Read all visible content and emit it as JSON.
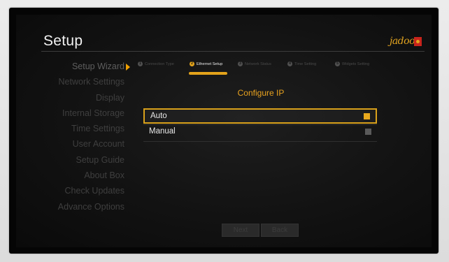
{
  "header": {
    "title": "Setup",
    "brand": "jadoo"
  },
  "sidebar": {
    "items": [
      {
        "label": "Setup Wizard",
        "active": true
      },
      {
        "label": "Network Settings"
      },
      {
        "label": "Display"
      },
      {
        "label": "Internal Storage"
      },
      {
        "label": "Time Settings"
      },
      {
        "label": "User Account"
      },
      {
        "label": "Setup Guide"
      },
      {
        "label": "About Box"
      },
      {
        "label": "Check Updates"
      },
      {
        "label": "Advance Options"
      }
    ]
  },
  "wizard": {
    "steps": [
      {
        "num": "1",
        "label": "Connection Type"
      },
      {
        "num": "2",
        "label": "Ethernet Setup",
        "active": true
      },
      {
        "num": "3",
        "label": "Network Status"
      },
      {
        "num": "4",
        "label": "Time Setting"
      },
      {
        "num": "5",
        "label": "Widgets Setting"
      }
    ]
  },
  "panel": {
    "title": "Configure IP",
    "options": [
      {
        "label": "Auto",
        "selected": true
      },
      {
        "label": "Manual",
        "selected": false
      }
    ]
  },
  "footer": {
    "next_label": "Next",
    "back_label": "Back"
  },
  "colors": {
    "accent": "#e3a31b",
    "background": "#121212"
  }
}
